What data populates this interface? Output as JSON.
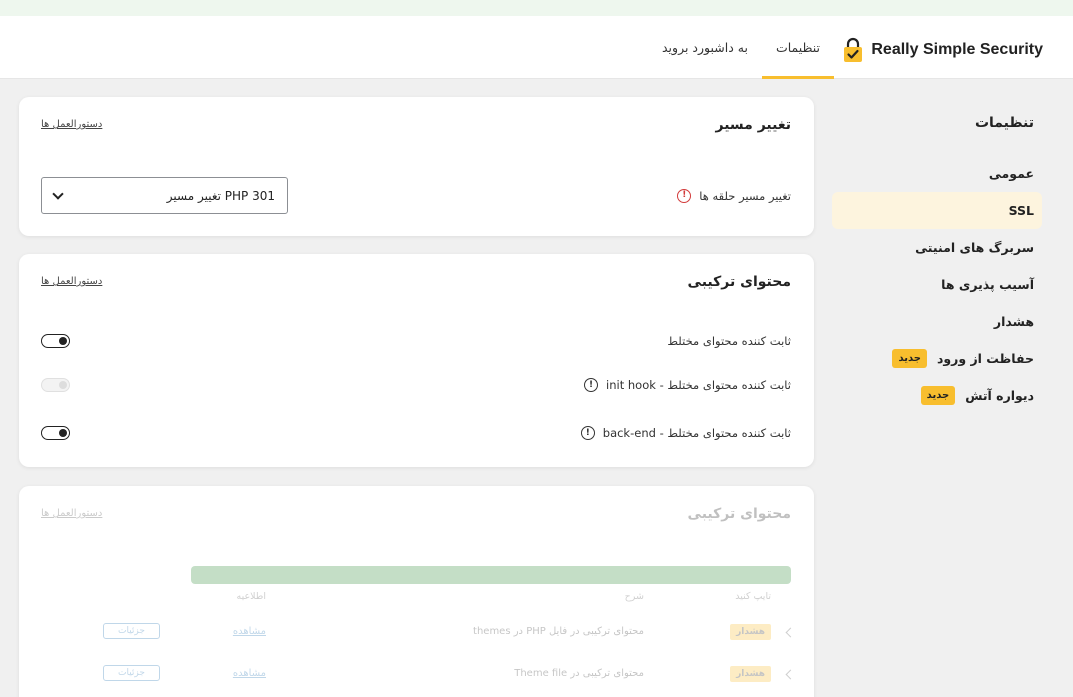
{
  "header": {
    "brand": "Really Simple Security",
    "nav": [
      {
        "label": "به داشبورد بروید",
        "active": false
      },
      {
        "label": "تنظیمات",
        "active": true
      }
    ]
  },
  "sidebar": {
    "title": "تنظیمات",
    "items": [
      {
        "label": "عمومی",
        "active": false,
        "badge": ""
      },
      {
        "label": "SSL",
        "active": true,
        "badge": ""
      },
      {
        "label": "سربرگ های امنیتی",
        "active": false,
        "badge": ""
      },
      {
        "label": "آسیب پذیری ها",
        "active": false,
        "badge": ""
      },
      {
        "label": "هشدار",
        "active": false,
        "badge": ""
      },
      {
        "label": "حفاظت از ورود",
        "active": false,
        "badge": "جدید"
      },
      {
        "label": "دیواره آتش",
        "active": false,
        "badge": "جدید"
      }
    ]
  },
  "redirect_card": {
    "title": "تغییر مسیر",
    "link": "دستورالعمل ها",
    "field_label": "تغییر مسیر حلقه ها",
    "select_value": "PHP 301 تغییر مسیر"
  },
  "mixed_card": {
    "title": "محتوای ترکیبی",
    "link": "دستورالعمل ها",
    "rows": [
      {
        "label": "ثابت کننده محتوای مختلط",
        "has_info": false,
        "enabled": true,
        "disabled": false
      },
      {
        "label": "ثابت کننده محتوای مختلط - init hook",
        "has_info": true,
        "enabled": false,
        "disabled": true
      },
      {
        "label": "ثابت کننده محتوای مختلط - back-end",
        "has_info": true,
        "enabled": true,
        "disabled": false
      }
    ]
  },
  "scan_card": {
    "title": "محتوای ترکیبی",
    "link": "دستورالعمل ها",
    "progress": 1.0,
    "columns": [
      "تایپ کنید",
      "شرح",
      "اطلاعیه"
    ],
    "rows": [
      {
        "type": "هشدار",
        "description": "محتوای ترکیبی در فایل PHP در themes",
        "info": "مشاهده",
        "action": "جزئیات"
      },
      {
        "type": "هشدار",
        "description": "محتوای ترکیبی در Theme file",
        "info": "مشاهده",
        "action": "جزئیات"
      }
    ]
  },
  "colors": {
    "accent": "#f8be2e",
    "accent_light": "#fdf4de",
    "progress": "#2e8a37",
    "link": "#2271b1",
    "warning": "#d23b3b"
  }
}
